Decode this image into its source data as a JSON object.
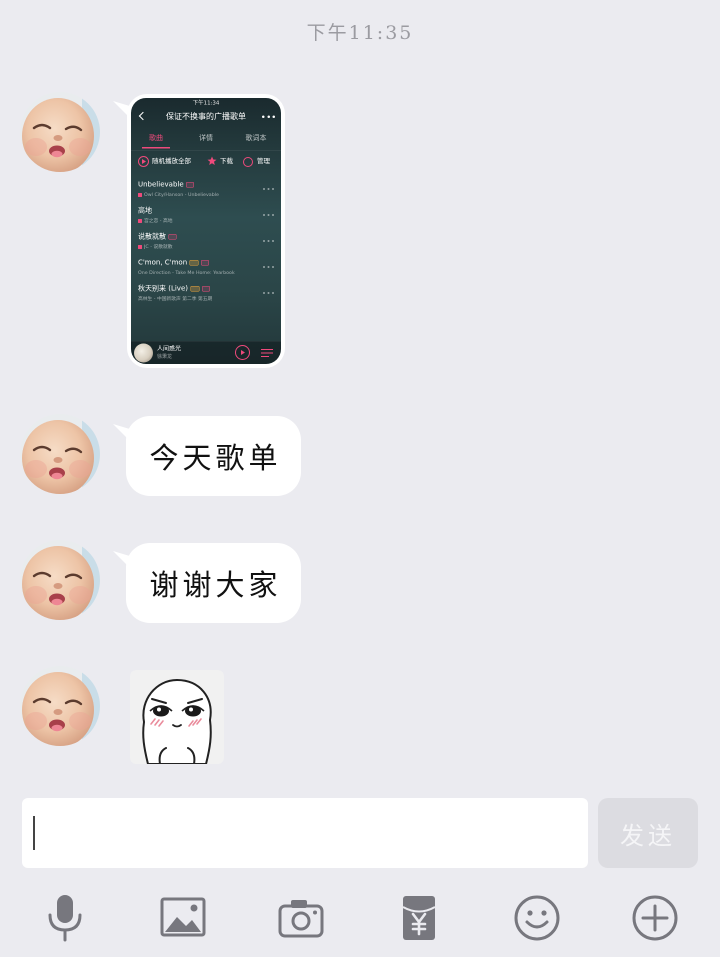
{
  "timestamp": "下午11:35",
  "colors": {
    "background": "#ebebf0",
    "bubble": "#ffffff",
    "accent_pink": "#ef4a7c",
    "icon_gray": "#77777e",
    "send_bg": "#dcdce1",
    "send_text": "#f5f5f7"
  },
  "messages": [
    {
      "type": "image",
      "avatar": "baby-avatar",
      "playlist": {
        "status_time": "下午11:34",
        "title": "保证不换事的广播歌单",
        "tabs": [
          "歌曲",
          "详情",
          "歌词本"
        ],
        "active_tab": 0,
        "actions": {
          "shuffle": "随机播放全部",
          "download": "下载",
          "manage": "管理"
        },
        "songs": [
          {
            "title": "Unbelievable",
            "subtitle": "Owl City/Hanson - Unbelievable"
          },
          {
            "title": "高地",
            "subtitle": "宫之恋 - 高地"
          },
          {
            "title": "说散就散",
            "subtitle": "JC - 说散就散"
          },
          {
            "title": "C'mon, C'mon",
            "subtitle": "One Direction - Take Me Home: Yearbook"
          },
          {
            "title": "秋天别来 (Live)",
            "subtitle": "高林生 - 中国新歌声 第二季 第五期"
          }
        ],
        "now_playing": {
          "title": "人间惑光",
          "artist": "徐秉龙"
        }
      }
    },
    {
      "type": "text",
      "avatar": "baby-avatar",
      "text": "今天歌单"
    },
    {
      "type": "text",
      "avatar": "baby-avatar",
      "text": "谢谢大家"
    },
    {
      "type": "sticker",
      "avatar": "baby-avatar",
      "sticker": "blushing-face-sticker"
    }
  ],
  "composer": {
    "send_label": "发送"
  },
  "toolbar": {
    "icons": [
      "microphone-icon",
      "image-icon",
      "camera-icon",
      "red-packet-icon",
      "emoji-icon",
      "plus-icon"
    ]
  }
}
